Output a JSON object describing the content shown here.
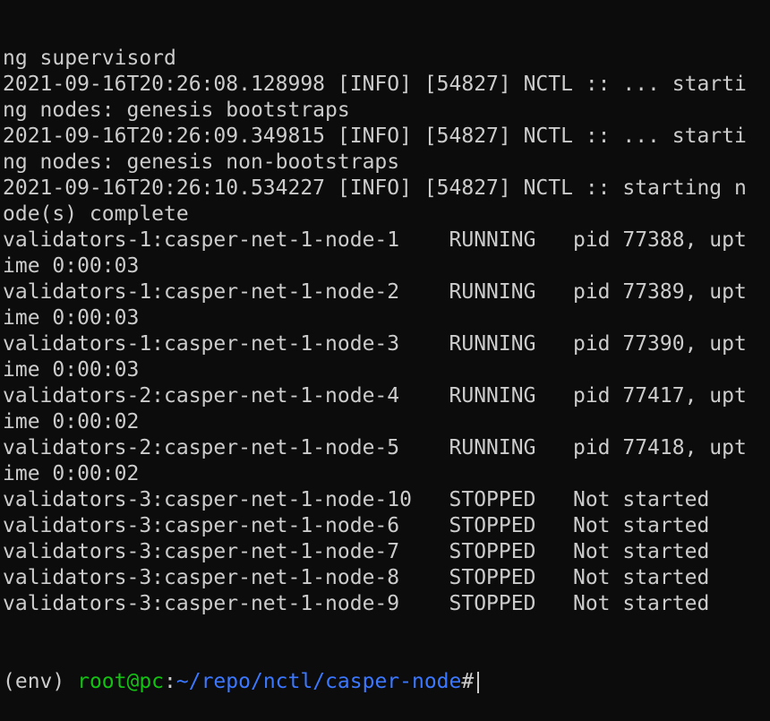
{
  "terminal": {
    "lines": [
      "ng supervisord",
      "2021-09-16T20:26:08.128998 [INFO] [54827] NCTL :: ... starti",
      "ng nodes: genesis bootstraps",
      "2021-09-16T20:26:09.349815 [INFO] [54827] NCTL :: ... starti",
      "ng nodes: genesis non-bootstraps",
      "2021-09-16T20:26:10.534227 [INFO] [54827] NCTL :: starting n",
      "ode(s) complete",
      "validators-1:casper-net-1-node-1    RUNNING   pid 77388, upt",
      "ime 0:00:03",
      "validators-1:casper-net-1-node-2    RUNNING   pid 77389, upt",
      "ime 0:00:03",
      "validators-1:casper-net-1-node-3    RUNNING   pid 77390, upt",
      "ime 0:00:03",
      "validators-2:casper-net-1-node-4    RUNNING   pid 77417, upt",
      "ime 0:00:02",
      "validators-2:casper-net-1-node-5    RUNNING   pid 77418, upt",
      "ime 0:00:02",
      "validators-3:casper-net-1-node-10   STOPPED   Not started",
      "validators-3:casper-net-1-node-6    STOPPED   Not started",
      "validators-3:casper-net-1-node-7    STOPPED   Not started",
      "validators-3:casper-net-1-node-8    STOPPED   Not started",
      "validators-3:casper-net-1-node-9    STOPPED   Not started"
    ],
    "prompt": {
      "env": "(env) ",
      "user_host": "root@pc",
      "sep": ":",
      "path": "~/repo/nctl/casper-node",
      "symbol": "#"
    }
  }
}
